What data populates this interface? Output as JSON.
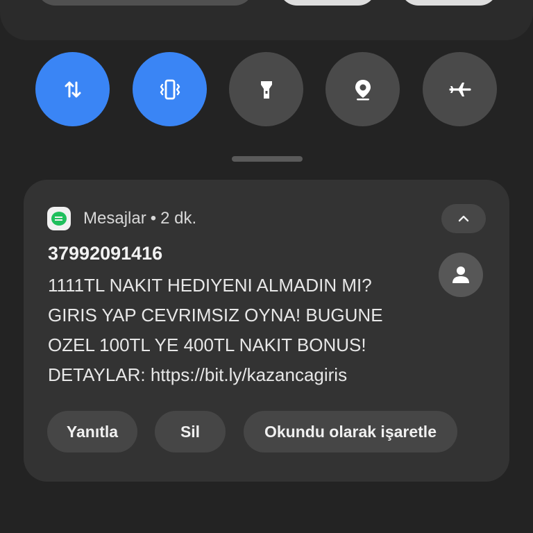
{
  "quick_settings": {
    "toggles": [
      {
        "name": "mobile-data",
        "icon": "data-arrows-icon",
        "active": true
      },
      {
        "name": "vibrate",
        "icon": "vibrate-icon",
        "active": true
      },
      {
        "name": "flashlight",
        "icon": "flashlight-icon",
        "active": false
      },
      {
        "name": "location",
        "icon": "location-pin-icon",
        "active": false
      },
      {
        "name": "airplane-mode",
        "icon": "airplane-icon",
        "active": false
      }
    ],
    "active_color": "#3a85f5",
    "inactive_color": "#4a4a4a"
  },
  "notification": {
    "app_name": "Mesajlar",
    "separator": "•",
    "time_ago": "2 dk.",
    "sender": "37992091416",
    "message_lines": [
      "1111TL NAKIT HEDIYENI ALMADIN MI?",
      "GIRIS YAP CEVRIMSIZ OYNA! BUGUNE",
      "OZEL 100TL YE 400TL NAKIT BONUS!",
      "DETAYLAR: https://bit.ly/kazancagiris"
    ],
    "app_icon_color": "#1fbf5c",
    "actions": {
      "reply": "Yanıtla",
      "delete": "Sil",
      "mark_read": "Okundu olarak işaretle"
    }
  }
}
